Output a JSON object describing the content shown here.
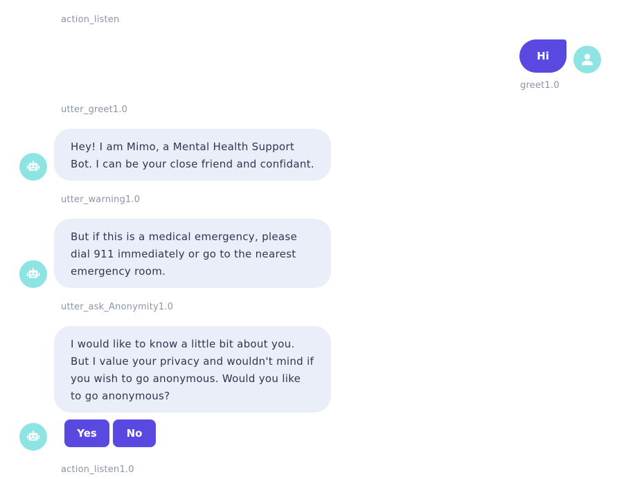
{
  "conversation": {
    "action_listen_label": "action_listen",
    "user_message": {
      "text": "Hi",
      "intent_label": "greet1.0"
    },
    "greet": {
      "label": "utter_greet1.0",
      "text": "Hey! I am Mimo, a Mental Health Support Bot. I can be your close friend and confidant."
    },
    "warning": {
      "label": "utter_warning1.0",
      "text": "But if this is a medical emergency, please dial 911 immediately or go to the nearest emergency room."
    },
    "anonymity": {
      "label": "utter_ask_Anonymity1.0",
      "text": "I would like to know a little bit about you. But I value your privacy and wouldn't mind if you wish to go anonymous. Would you like to go anonymous?",
      "buttons": [
        "Yes",
        "No"
      ]
    },
    "action_listen_final_label": "action_listen1.0"
  },
  "icons": {
    "bot": "robot-icon",
    "user": "user-icon"
  },
  "colors": {
    "accent": "#5a49e0",
    "avatar_bg": "#8ee3e3",
    "bot_bubble": "#eaeef8",
    "label": "#8b93a7",
    "text": "#2e3550"
  }
}
